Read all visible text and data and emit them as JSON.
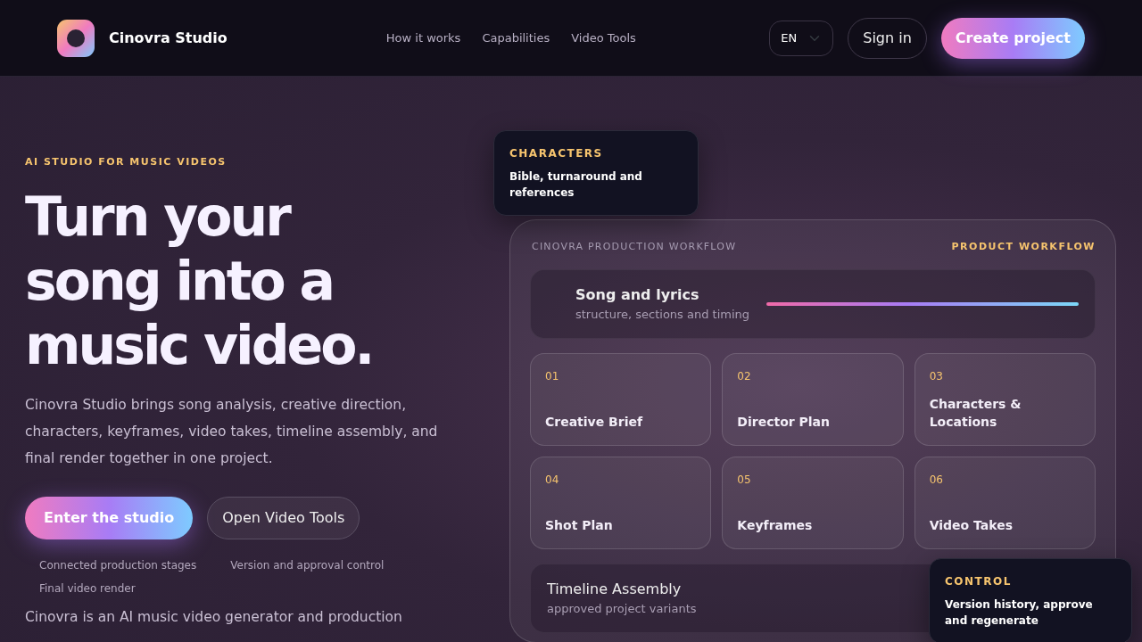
{
  "nav": {
    "brand": "Cinovra Studio",
    "links": [
      "How it works",
      "Capabilities",
      "Video Tools"
    ],
    "language": "EN",
    "sign_in": "Sign in",
    "cta": "Create project"
  },
  "hero": {
    "eyebrow": "AI STUDIO FOR MUSIC VIDEOS",
    "title_lines": [
      "Turn your",
      "song into a",
      "music video."
    ],
    "lead": "Cinovra Studio brings song analysis, creative direction, characters, keyframes, video takes, timeline assembly, and final render together in one project.",
    "buttons": [
      {
        "label": "Enter the studio",
        "kind": "primary"
      },
      {
        "label": "Open Video Tools",
        "kind": "secondary"
      }
    ],
    "features": [
      "Connected production stages",
      "Version and approval control",
      "Final video render"
    ],
    "note": "Cinovra is an AI music video generator and production"
  },
  "workflow": {
    "label": "CINOVRA PRODUCTION WORKFLOW",
    "tag": "PRODUCT WORKFLOW",
    "song": {
      "title": "Song and lyrics",
      "subtitle": "structure, sections and timing"
    },
    "stages": [
      {
        "number": "01",
        "title": "Creative Brief"
      },
      {
        "number": "02",
        "title": "Director Plan"
      },
      {
        "number": "03",
        "title": "Characters & Locations"
      },
      {
        "number": "04",
        "title": "Shot Plan"
      },
      {
        "number": "05",
        "title": "Keyframes"
      },
      {
        "number": "06",
        "title": "Video Takes"
      }
    ],
    "timeline": {
      "title": "Timeline Assembly",
      "subtitle": "approved project variants"
    }
  },
  "callouts": [
    {
      "title": "CHARACTERS",
      "text": "Bible, turnaround and references"
    },
    {
      "title": "CONTROL",
      "text": "Version history, approve and regenerate"
    }
  ]
}
